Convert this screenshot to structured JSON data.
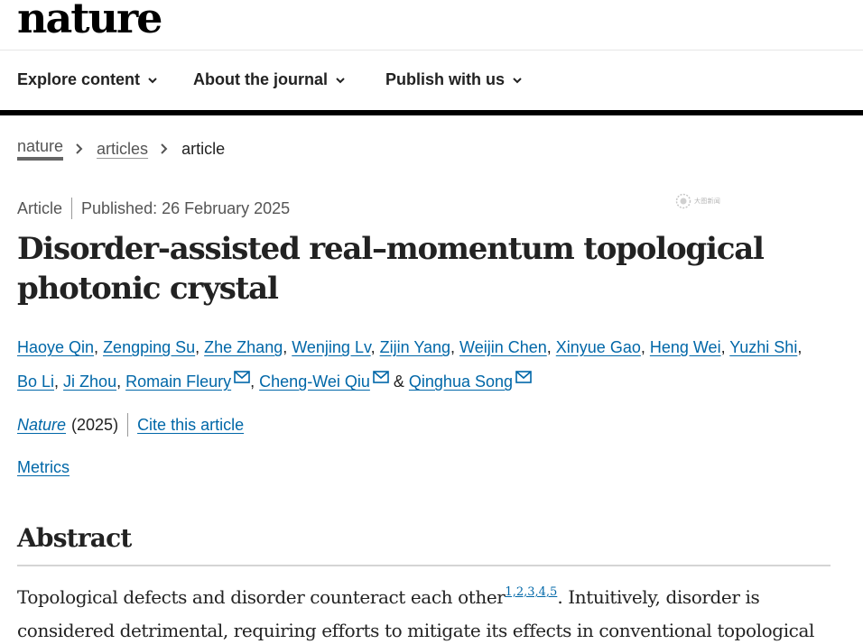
{
  "header": {
    "logo": "nature"
  },
  "nav": {
    "items": [
      {
        "label": "Explore content"
      },
      {
        "label": "About the journal"
      },
      {
        "label": "Publish with us"
      }
    ]
  },
  "breadcrumb": {
    "home": "nature",
    "section": "articles",
    "current": "article"
  },
  "article": {
    "type": "Article",
    "published": "Published: 26 February 2025",
    "title_line1": "Disorder-assisted real–momentum topological",
    "title_line2": "photonic crystal",
    "authors": [
      "Haoye Qin",
      "Zengping Su",
      "Zhe Zhang",
      "Wenjing Lv",
      "Zijin Yang",
      "Weijin Chen",
      "Xinyue Gao",
      "Heng Wei",
      "Yuzhi Shi",
      "Bo Li",
      "Ji Zhou",
      "Romain Fleury",
      "Cheng-Wei Qiu",
      "Qinghua Song"
    ],
    "journal": "Nature",
    "year": "(2025)",
    "cite_label": "Cite this article",
    "metrics_label": "Metrics"
  },
  "abstract": {
    "heading": "Abstract",
    "text_start": "Topological defects and disorder counteract each other",
    "refs": "1,2,3,4,5",
    "text_rest": ". Intuitively, disorder is considered detrimental, requiring efforts to mitigate its effects in conventional topological"
  },
  "watermark": {
    "text": "大图新闻"
  },
  "colors": {
    "link": "#0067a8",
    "text": "#222222",
    "rule": "#000000"
  },
  "icons": {
    "nav_chevron": "chevron-down-icon",
    "breadcrumb_sep": "chevron-right-icon",
    "author_email": "mail-icon"
  }
}
